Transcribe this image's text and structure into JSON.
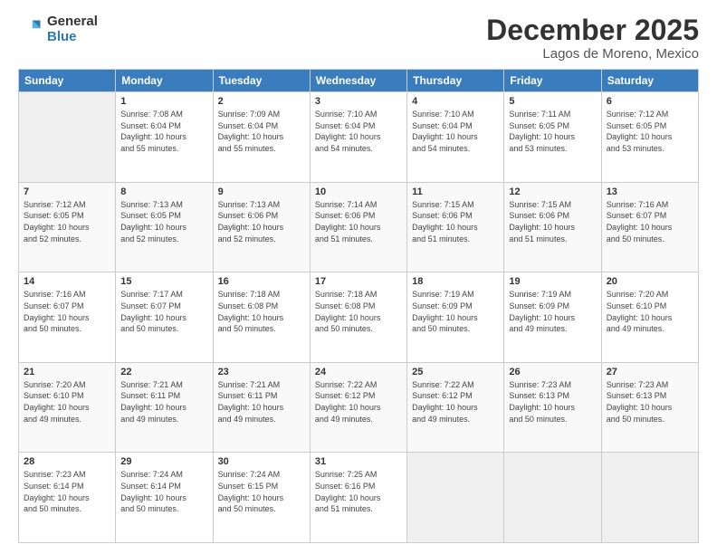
{
  "logo": {
    "general": "General",
    "blue": "Blue"
  },
  "title": "December 2025",
  "subtitle": "Lagos de Moreno, Mexico",
  "days_header": [
    "Sunday",
    "Monday",
    "Tuesday",
    "Wednesday",
    "Thursday",
    "Friday",
    "Saturday"
  ],
  "weeks": [
    [
      {
        "day": "",
        "info": ""
      },
      {
        "day": "1",
        "info": "Sunrise: 7:08 AM\nSunset: 6:04 PM\nDaylight: 10 hours\nand 55 minutes."
      },
      {
        "day": "2",
        "info": "Sunrise: 7:09 AM\nSunset: 6:04 PM\nDaylight: 10 hours\nand 55 minutes."
      },
      {
        "day": "3",
        "info": "Sunrise: 7:10 AM\nSunset: 6:04 PM\nDaylight: 10 hours\nand 54 minutes."
      },
      {
        "day": "4",
        "info": "Sunrise: 7:10 AM\nSunset: 6:04 PM\nDaylight: 10 hours\nand 54 minutes."
      },
      {
        "day": "5",
        "info": "Sunrise: 7:11 AM\nSunset: 6:05 PM\nDaylight: 10 hours\nand 53 minutes."
      },
      {
        "day": "6",
        "info": "Sunrise: 7:12 AM\nSunset: 6:05 PM\nDaylight: 10 hours\nand 53 minutes."
      }
    ],
    [
      {
        "day": "7",
        "info": "Sunrise: 7:12 AM\nSunset: 6:05 PM\nDaylight: 10 hours\nand 52 minutes."
      },
      {
        "day": "8",
        "info": "Sunrise: 7:13 AM\nSunset: 6:05 PM\nDaylight: 10 hours\nand 52 minutes."
      },
      {
        "day": "9",
        "info": "Sunrise: 7:13 AM\nSunset: 6:06 PM\nDaylight: 10 hours\nand 52 minutes."
      },
      {
        "day": "10",
        "info": "Sunrise: 7:14 AM\nSunset: 6:06 PM\nDaylight: 10 hours\nand 51 minutes."
      },
      {
        "day": "11",
        "info": "Sunrise: 7:15 AM\nSunset: 6:06 PM\nDaylight: 10 hours\nand 51 minutes."
      },
      {
        "day": "12",
        "info": "Sunrise: 7:15 AM\nSunset: 6:06 PM\nDaylight: 10 hours\nand 51 minutes."
      },
      {
        "day": "13",
        "info": "Sunrise: 7:16 AM\nSunset: 6:07 PM\nDaylight: 10 hours\nand 50 minutes."
      }
    ],
    [
      {
        "day": "14",
        "info": "Sunrise: 7:16 AM\nSunset: 6:07 PM\nDaylight: 10 hours\nand 50 minutes."
      },
      {
        "day": "15",
        "info": "Sunrise: 7:17 AM\nSunset: 6:07 PM\nDaylight: 10 hours\nand 50 minutes."
      },
      {
        "day": "16",
        "info": "Sunrise: 7:18 AM\nSunset: 6:08 PM\nDaylight: 10 hours\nand 50 minutes."
      },
      {
        "day": "17",
        "info": "Sunrise: 7:18 AM\nSunset: 6:08 PM\nDaylight: 10 hours\nand 50 minutes."
      },
      {
        "day": "18",
        "info": "Sunrise: 7:19 AM\nSunset: 6:09 PM\nDaylight: 10 hours\nand 50 minutes."
      },
      {
        "day": "19",
        "info": "Sunrise: 7:19 AM\nSunset: 6:09 PM\nDaylight: 10 hours\nand 49 minutes."
      },
      {
        "day": "20",
        "info": "Sunrise: 7:20 AM\nSunset: 6:10 PM\nDaylight: 10 hours\nand 49 minutes."
      }
    ],
    [
      {
        "day": "21",
        "info": "Sunrise: 7:20 AM\nSunset: 6:10 PM\nDaylight: 10 hours\nand 49 minutes."
      },
      {
        "day": "22",
        "info": "Sunrise: 7:21 AM\nSunset: 6:11 PM\nDaylight: 10 hours\nand 49 minutes."
      },
      {
        "day": "23",
        "info": "Sunrise: 7:21 AM\nSunset: 6:11 PM\nDaylight: 10 hours\nand 49 minutes."
      },
      {
        "day": "24",
        "info": "Sunrise: 7:22 AM\nSunset: 6:12 PM\nDaylight: 10 hours\nand 49 minutes."
      },
      {
        "day": "25",
        "info": "Sunrise: 7:22 AM\nSunset: 6:12 PM\nDaylight: 10 hours\nand 49 minutes."
      },
      {
        "day": "26",
        "info": "Sunrise: 7:23 AM\nSunset: 6:13 PM\nDaylight: 10 hours\nand 50 minutes."
      },
      {
        "day": "27",
        "info": "Sunrise: 7:23 AM\nSunset: 6:13 PM\nDaylight: 10 hours\nand 50 minutes."
      }
    ],
    [
      {
        "day": "28",
        "info": "Sunrise: 7:23 AM\nSunset: 6:14 PM\nDaylight: 10 hours\nand 50 minutes."
      },
      {
        "day": "29",
        "info": "Sunrise: 7:24 AM\nSunset: 6:14 PM\nDaylight: 10 hours\nand 50 minutes."
      },
      {
        "day": "30",
        "info": "Sunrise: 7:24 AM\nSunset: 6:15 PM\nDaylight: 10 hours\nand 50 minutes."
      },
      {
        "day": "31",
        "info": "Sunrise: 7:25 AM\nSunset: 6:16 PM\nDaylight: 10 hours\nand 51 minutes."
      },
      {
        "day": "",
        "info": ""
      },
      {
        "day": "",
        "info": ""
      },
      {
        "day": "",
        "info": ""
      }
    ]
  ]
}
